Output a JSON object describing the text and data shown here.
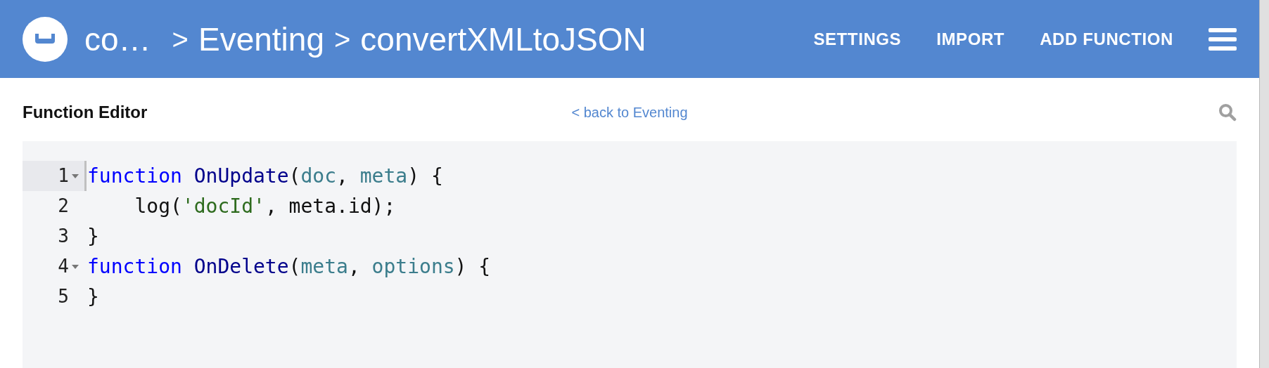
{
  "header": {
    "breadcrumbs": [
      {
        "label": "co…"
      },
      {
        "label": "Eventing"
      },
      {
        "label": "convertXMLtoJSON"
      }
    ],
    "separator": ">",
    "nav": [
      {
        "label": "SETTINGS"
      },
      {
        "label": "IMPORT"
      },
      {
        "label": "ADD FUNCTION"
      }
    ]
  },
  "editor_panel": {
    "title": "Function Editor",
    "back_link": "< back to Eventing"
  },
  "code": {
    "lines": [
      {
        "number": "1",
        "foldable": true,
        "active": true,
        "tokens": [
          {
            "text": "function",
            "kind": "keyword"
          },
          {
            "text": " OnUpdate",
            "kind": "def"
          },
          {
            "text": "(",
            "kind": "plain"
          },
          {
            "text": "doc",
            "kind": "param"
          },
          {
            "text": ", ",
            "kind": "plain"
          },
          {
            "text": "meta",
            "kind": "param"
          },
          {
            "text": ") {",
            "kind": "plain"
          }
        ]
      },
      {
        "number": "2",
        "foldable": false,
        "active": false,
        "tokens": [
          {
            "text": "    log(",
            "kind": "plain"
          },
          {
            "text": "'docId'",
            "kind": "string"
          },
          {
            "text": ", meta.id);",
            "kind": "plain"
          }
        ]
      },
      {
        "number": "3",
        "foldable": false,
        "active": false,
        "tokens": [
          {
            "text": "}",
            "kind": "plain"
          }
        ]
      },
      {
        "number": "4",
        "foldable": true,
        "active": false,
        "tokens": [
          {
            "text": "function",
            "kind": "keyword"
          },
          {
            "text": " OnDelete",
            "kind": "def"
          },
          {
            "text": "(",
            "kind": "plain"
          },
          {
            "text": "meta",
            "kind": "param"
          },
          {
            "text": ", ",
            "kind": "plain"
          },
          {
            "text": "options",
            "kind": "param"
          },
          {
            "text": ") {",
            "kind": "plain"
          }
        ]
      },
      {
        "number": "5",
        "foldable": false,
        "active": false,
        "tokens": [
          {
            "text": "}",
            "kind": "plain"
          }
        ]
      }
    ]
  }
}
